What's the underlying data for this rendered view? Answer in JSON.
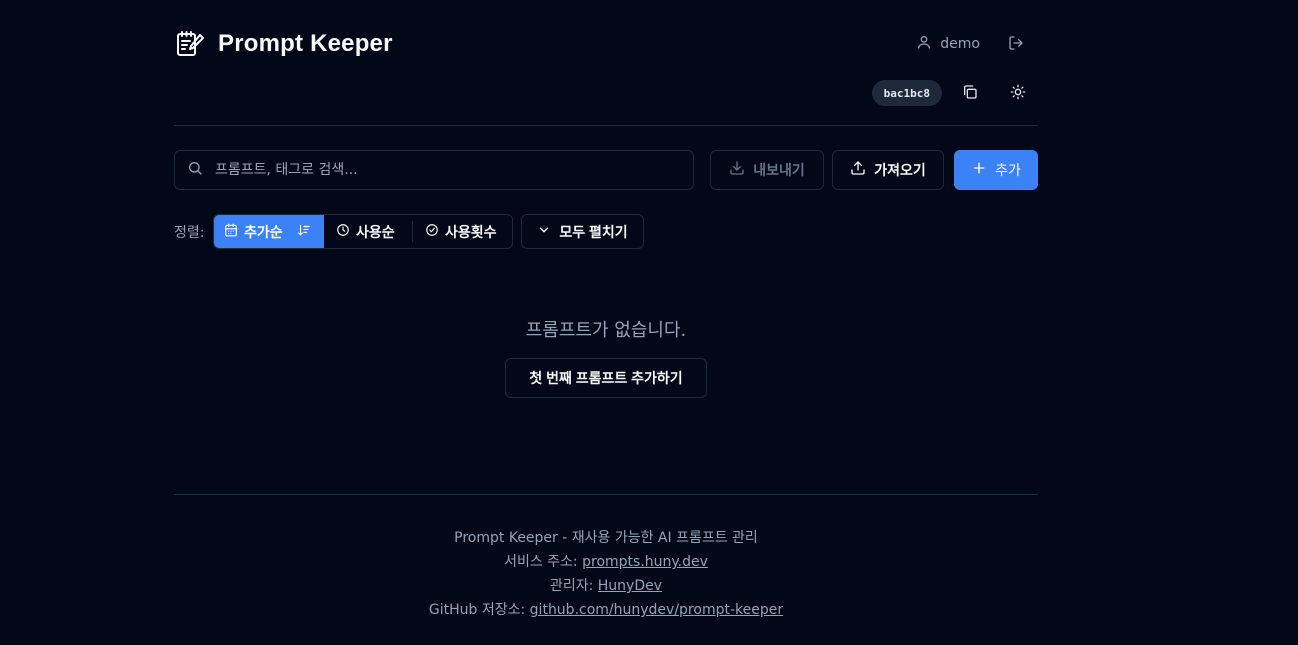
{
  "header": {
    "app_title": "Prompt Keeper",
    "user_name": "demo",
    "hash_badge": "bac1bc8"
  },
  "toolbar": {
    "search_placeholder": "프롬프트, 태그로 검색...",
    "export_label": "내보내기",
    "import_label": "가져오기",
    "add_label": "추가"
  },
  "sort": {
    "label": "정렬:",
    "options": [
      {
        "label": "추가순",
        "active": true
      },
      {
        "label": "사용순",
        "active": false
      },
      {
        "label": "사용횟수",
        "active": false
      }
    ],
    "expand_all_label": "모두 펼치기"
  },
  "empty_state": {
    "message": "프롬프트가 없습니다.",
    "cta_label": "첫 번째 프롬프트 추가하기"
  },
  "footer": {
    "line1": "Prompt Keeper - 재사용 가능한 AI 프롬프트 관리",
    "service_prefix": "서비스 주소: ",
    "service_link": "prompts.huny.dev",
    "admin_prefix": "관리자: ",
    "admin_link": "HunyDev",
    "github_prefix": "GitHub 저장소: ",
    "github_link": "github.com/hunydev/prompt-keeper"
  },
  "colors": {
    "background": "#020817",
    "accent": "#3b82f6",
    "border": "#1e293b",
    "muted_text": "#94a3b8"
  }
}
